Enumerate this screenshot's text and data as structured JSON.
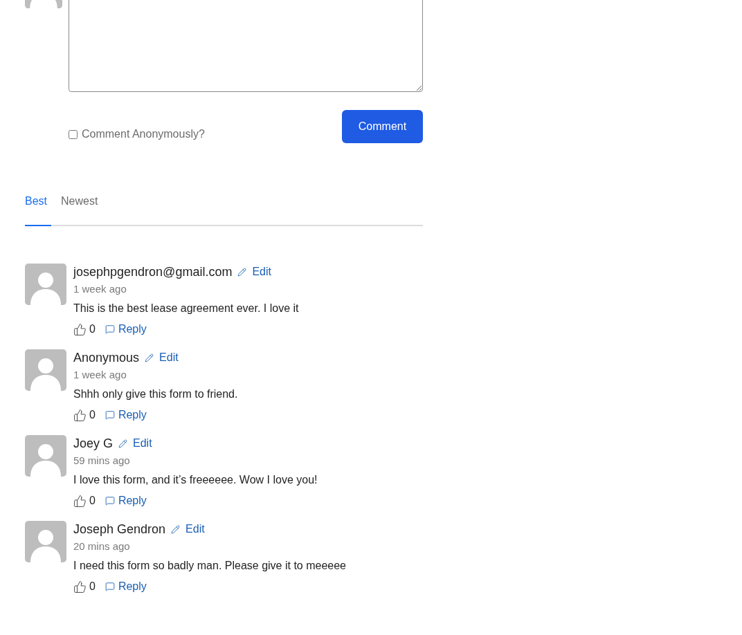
{
  "new_comment": {
    "anonymous_checkbox": {
      "label": "Comment Anonymously?",
      "checked": false
    },
    "submit_button": "Comment"
  },
  "sort_tabs": [
    {
      "label": "Best",
      "selected": true
    },
    {
      "label": "Newest",
      "selected": false
    }
  ],
  "comments": [
    {
      "author": "josephpgendron@gmail.com",
      "edit_label": "Edit",
      "time": "1 week ago",
      "body": "This is the best lease agreement ever. I love it",
      "likes": "0",
      "reply_label": "Reply"
    },
    {
      "author": "Anonymous",
      "edit_label": "Edit",
      "time": "1 week ago",
      "body": "Shhh only give this form to friend.",
      "likes": "0",
      "reply_label": "Reply"
    },
    {
      "author": "Joey G",
      "edit_label": "Edit",
      "time": "59 mins ago",
      "body": "I love this form, and it’s freeeeee. Wow I love you!",
      "likes": "0",
      "reply_label": "Reply"
    },
    {
      "author": "Joseph Gendron",
      "edit_label": "Edit",
      "time": "20 mins ago",
      "body": "I need this form so badly man. Please give it to meeeee",
      "likes": "0",
      "reply_label": "Reply"
    }
  ]
}
